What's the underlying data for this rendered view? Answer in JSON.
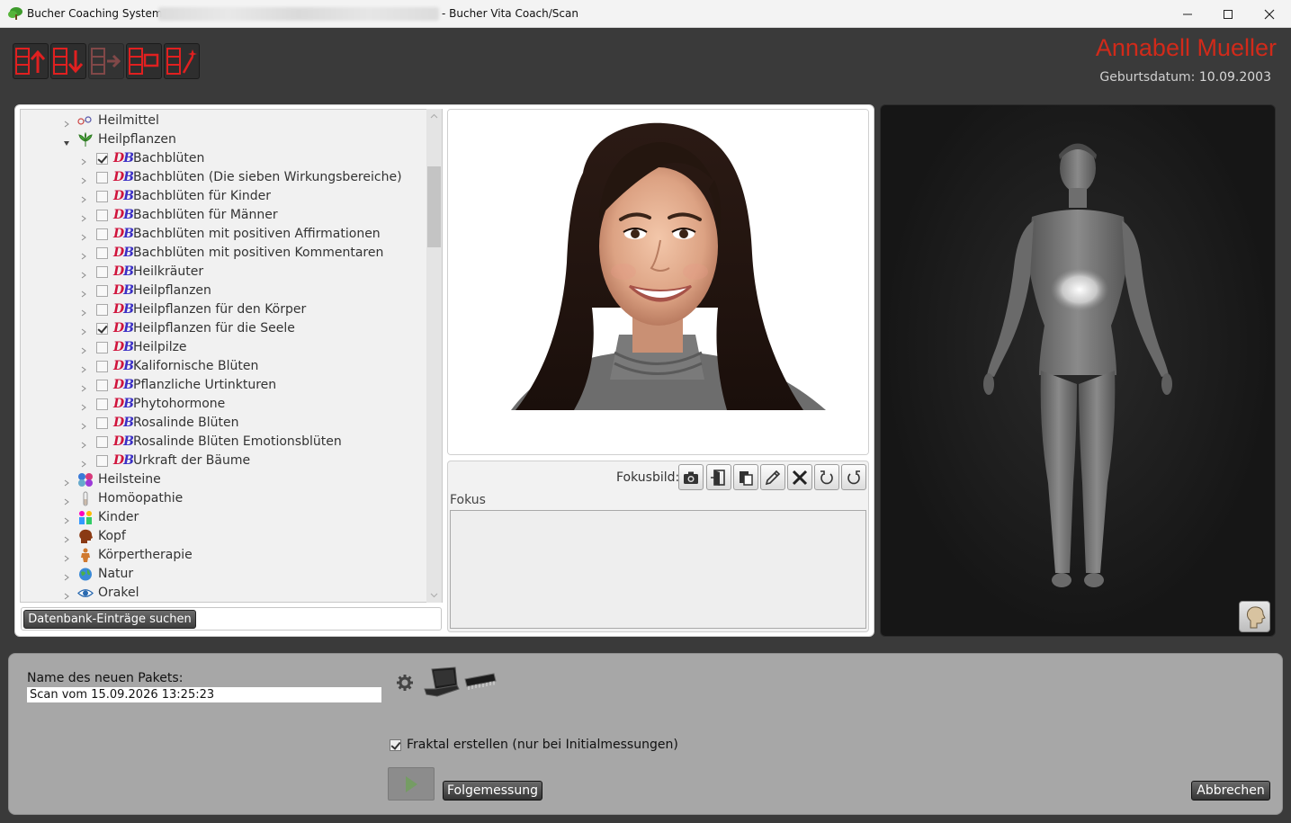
{
  "window": {
    "title_left": "Bucher Coaching Systems -",
    "title_right": "- Bucher Vita Coach/Scan"
  },
  "patient": {
    "name": "Annabell Mueller",
    "dob_label": "Geburtsdatum:",
    "dob": "10.09.2003"
  },
  "tree": {
    "items": [
      {
        "label": "Heilmittel",
        "level": 0,
        "expanded": false,
        "icon": "molecule-icon"
      },
      {
        "label": "Heilpflanzen",
        "level": 0,
        "expanded": true,
        "icon": "plant-icon"
      },
      {
        "label": "Bachblüten",
        "level": 1,
        "checked": true
      },
      {
        "label": "Bachblüten (Die sieben Wirkungsbereiche)",
        "level": 1,
        "checked": false
      },
      {
        "label": "Bachblüten für Kinder",
        "level": 1,
        "checked": false
      },
      {
        "label": "Bachblüten für Männer",
        "level": 1,
        "checked": false
      },
      {
        "label": "Bachblüten mit positiven Affirmationen",
        "level": 1,
        "checked": false
      },
      {
        "label": "Bachblüten mit positiven Kommentaren",
        "level": 1,
        "checked": false
      },
      {
        "label": "Heilkräuter",
        "level": 1,
        "checked": false
      },
      {
        "label": "Heilpflanzen",
        "level": 1,
        "checked": false
      },
      {
        "label": "Heilpflanzen für den Körper",
        "level": 1,
        "checked": false
      },
      {
        "label": "Heilpflanzen für die Seele",
        "level": 1,
        "checked": true
      },
      {
        "label": "Heilpilze",
        "level": 1,
        "checked": false
      },
      {
        "label": "Kalifornische Blüten",
        "level": 1,
        "checked": false
      },
      {
        "label": "Pflanzliche Urtinkturen",
        "level": 1,
        "checked": false
      },
      {
        "label": "Phytohormone",
        "level": 1,
        "checked": false
      },
      {
        "label": "Rosalinde Blüten",
        "level": 1,
        "checked": false
      },
      {
        "label": "Rosalinde Blüten Emotionsblüten",
        "level": 1,
        "checked": false
      },
      {
        "label": "Urkraft der Bäume",
        "level": 1,
        "checked": false
      },
      {
        "label": "Heilsteine",
        "level": 0,
        "expanded": false,
        "icon": "gems-icon"
      },
      {
        "label": "Homöopathie",
        "level": 0,
        "expanded": false,
        "icon": "vial-icon"
      },
      {
        "label": "Kinder",
        "level": 0,
        "expanded": false,
        "icon": "children-icon"
      },
      {
        "label": "Kopf",
        "level": 0,
        "expanded": false,
        "icon": "head-icon"
      },
      {
        "label": "Körpertherapie",
        "level": 0,
        "expanded": false,
        "icon": "body-icon"
      },
      {
        "label": "Natur",
        "level": 0,
        "expanded": false,
        "icon": "globe-icon"
      },
      {
        "label": "Orakel",
        "level": 0,
        "expanded": false,
        "icon": "eye-icon"
      }
    ],
    "db_glyph_d": "D",
    "db_glyph_b": "B",
    "search_button": "Datenbank-Einträge suchen"
  },
  "focus": {
    "image_label": "Fokusbild:",
    "title": "Fokus",
    "text": ""
  },
  "bottom": {
    "package_label": "Name des neuen Pakets:",
    "package_value": "Scan vom 15.09.2026 13:25:23",
    "fraktal_label": "Fraktal erstellen (nur bei Initialmessungen)",
    "fraktal_checked": true,
    "followup_button": "Folgemessung",
    "cancel_button": "Abbrechen"
  },
  "colors": {
    "patient_name": "#d12a1a",
    "background": "#3a3a3a",
    "bottom_panel": "#a7a7a7"
  }
}
